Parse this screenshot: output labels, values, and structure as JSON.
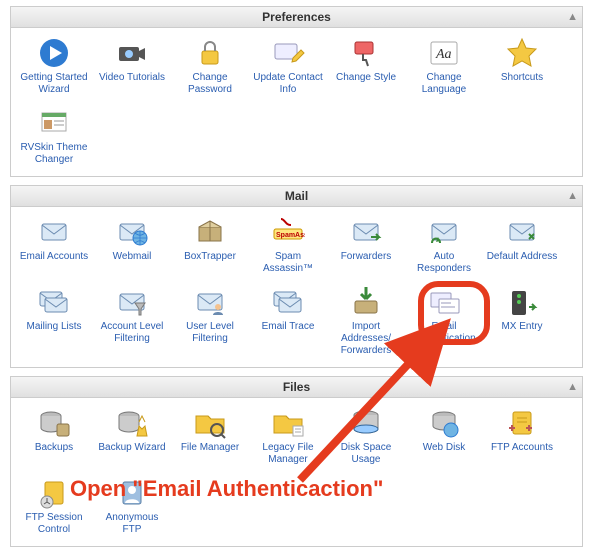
{
  "annotation": {
    "text": "Open \"Email Authenticaction\""
  },
  "panels": [
    {
      "key": "preferences",
      "title": "Preferences",
      "items": [
        {
          "key": "getting-started-wizard",
          "label": "Getting Started Wizard",
          "icon": "play"
        },
        {
          "key": "video-tutorials",
          "label": "Video Tutorials",
          "icon": "camera"
        },
        {
          "key": "change-password",
          "label": "Change Password",
          "icon": "lock"
        },
        {
          "key": "update-contact-info",
          "label": "Update Contact Info",
          "icon": "card-pencil"
        },
        {
          "key": "change-style",
          "label": "Change Style",
          "icon": "paint"
        },
        {
          "key": "change-language",
          "label": "Change Language",
          "icon": "language"
        },
        {
          "key": "shortcuts",
          "label": "Shortcuts",
          "icon": "star"
        },
        {
          "key": "rvskin-theme-changer",
          "label": "RVSkin Theme Changer",
          "icon": "theme"
        }
      ]
    },
    {
      "key": "mail",
      "title": "Mail",
      "items": [
        {
          "key": "email-accounts",
          "label": "Email Accounts",
          "icon": "envelope"
        },
        {
          "key": "webmail",
          "label": "Webmail",
          "icon": "envelope-globe"
        },
        {
          "key": "boxtrapper",
          "label": "BoxTrapper",
          "icon": "boxtrap"
        },
        {
          "key": "spam-assassin",
          "label": "Spam Assassin™",
          "icon": "spam"
        },
        {
          "key": "forwarders",
          "label": "Forwarders",
          "icon": "forward"
        },
        {
          "key": "auto-responders",
          "label": "Auto Responders",
          "icon": "auto"
        },
        {
          "key": "default-address",
          "label": "Default Address",
          "icon": "default-addr"
        },
        {
          "key": "mailing-lists",
          "label": "Mailing Lists",
          "icon": "envelopes"
        },
        {
          "key": "account-level-filtering",
          "label": "Account Level Filtering",
          "icon": "filter-acct"
        },
        {
          "key": "user-level-filtering",
          "label": "User Level Filtering",
          "icon": "filter-user"
        },
        {
          "key": "email-trace",
          "label": "Email Trace",
          "icon": "envelopes"
        },
        {
          "key": "import-addresses-forwarders",
          "label": "Import Addresses/ Forwarders",
          "icon": "import"
        },
        {
          "key": "email-authentication",
          "label": "Email Authentication",
          "icon": "auth",
          "highlight": true
        },
        {
          "key": "mx-entry",
          "label": "MX Entry",
          "icon": "mx"
        }
      ]
    },
    {
      "key": "files",
      "title": "Files",
      "items": [
        {
          "key": "backups",
          "label": "Backups",
          "icon": "backup"
        },
        {
          "key": "backup-wizard",
          "label": "Backup Wizard",
          "icon": "backup-wiz"
        },
        {
          "key": "file-manager",
          "label": "File Manager",
          "icon": "folder"
        },
        {
          "key": "legacy-file-manager",
          "label": "Legacy File Manager",
          "icon": "folder-old"
        },
        {
          "key": "disk-space-usage",
          "label": "Disk Space Usage",
          "icon": "disk"
        },
        {
          "key": "web-disk",
          "label": "Web Disk",
          "icon": "webdisk"
        },
        {
          "key": "ftp-accounts",
          "label": "FTP Accounts",
          "icon": "ftp"
        },
        {
          "key": "ftp-session-control",
          "label": "FTP Session Control",
          "icon": "ftp-sess"
        },
        {
          "key": "anonymous-ftp",
          "label": "Anonymous FTP",
          "icon": "ftp-anon"
        }
      ]
    }
  ]
}
